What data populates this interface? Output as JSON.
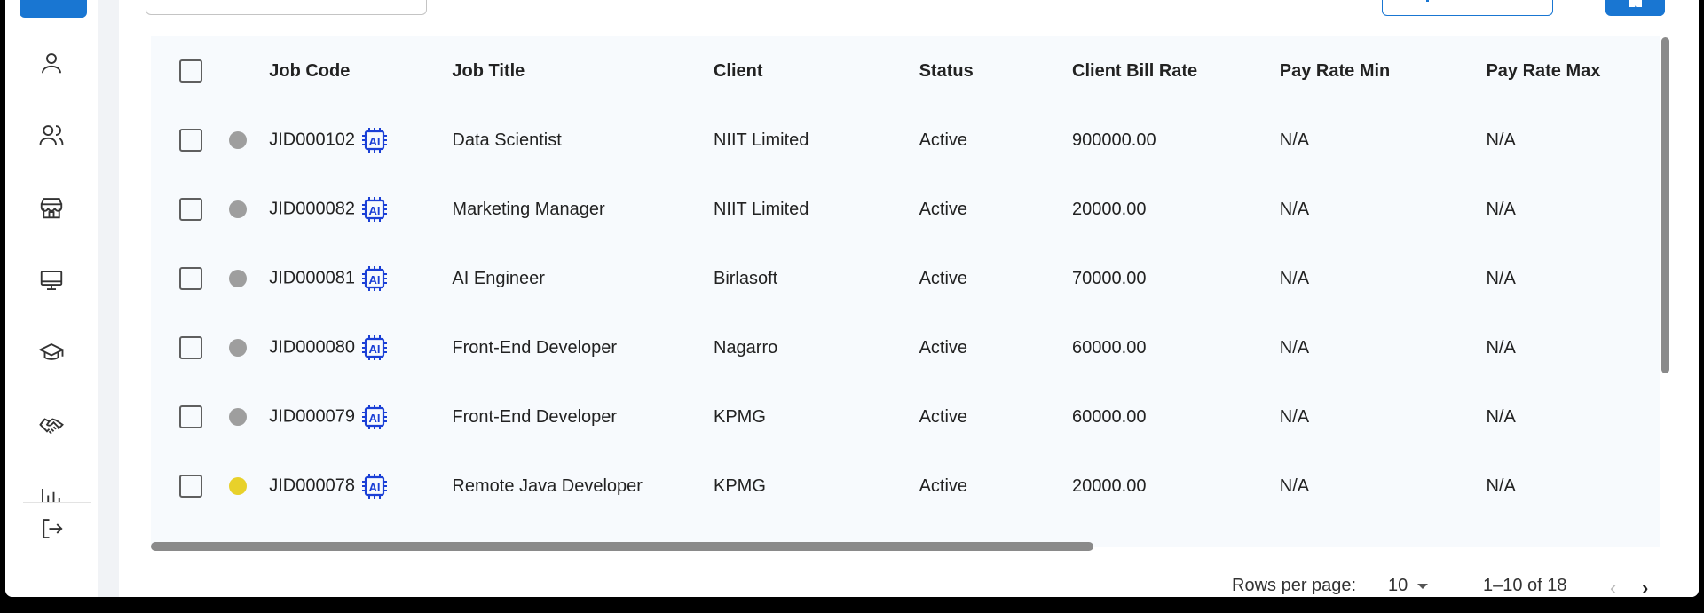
{
  "table": {
    "columns": [
      "Job Code",
      "Job Title",
      "Client",
      "Status",
      "Client Bill Rate",
      "Pay Rate Min",
      "Pay Rate Max"
    ],
    "rows": [
      {
        "job_code": "JID000102",
        "job_title": "Data Scientist",
        "client": "NIIT Limited",
        "status": "Active",
        "client_bill_rate": "900000.00",
        "pay_rate_min": "N/A",
        "pay_rate_max": "N/A",
        "dot_color": "#9e9e9e"
      },
      {
        "job_code": "JID000082",
        "job_title": "Marketing Manager",
        "client": "NIIT Limited",
        "status": "Active",
        "client_bill_rate": "20000.00",
        "pay_rate_min": "N/A",
        "pay_rate_max": "N/A",
        "dot_color": "#9e9e9e"
      },
      {
        "job_code": "JID000081",
        "job_title": "AI Engineer",
        "client": "Birlasoft",
        "status": "Active",
        "client_bill_rate": "70000.00",
        "pay_rate_min": "N/A",
        "pay_rate_max": "N/A",
        "dot_color": "#9e9e9e"
      },
      {
        "job_code": "JID000080",
        "job_title": "Front-End Developer",
        "client": "Nagarro",
        "status": "Active",
        "client_bill_rate": "60000.00",
        "pay_rate_min": "N/A",
        "pay_rate_max": "N/A",
        "dot_color": "#9e9e9e"
      },
      {
        "job_code": "JID000079",
        "job_title": "Front-End Developer",
        "client": "KPMG",
        "status": "Active",
        "client_bill_rate": "60000.00",
        "pay_rate_min": "N/A",
        "pay_rate_max": "N/A",
        "dot_color": "#9e9e9e"
      },
      {
        "job_code": "JID000078",
        "job_title": "Remote Java Developer",
        "client": "KPMG",
        "status": "Active",
        "client_bill_rate": "20000.00",
        "pay_rate_min": "N/A",
        "pay_rate_max": "N/A",
        "dot_color": "#e8d12a"
      }
    ],
    "ai_badge_text": "AI"
  },
  "pagination": {
    "rows_per_page_label": "Rows per page:",
    "rows_per_page_value": "10",
    "range": "1–10 of 18"
  },
  "sidebar": {
    "icons": [
      "user-icon",
      "users-icon",
      "store-icon",
      "monitor-icon",
      "graduation-cap-icon",
      "handshake-icon",
      "bar-chart-icon",
      "logout-icon"
    ]
  },
  "colors": {
    "accent": "#1976d2",
    "ai_badge": "#1a3fd6",
    "dot_inactive": "#9e9e9e",
    "dot_pending": "#e8d12a"
  }
}
